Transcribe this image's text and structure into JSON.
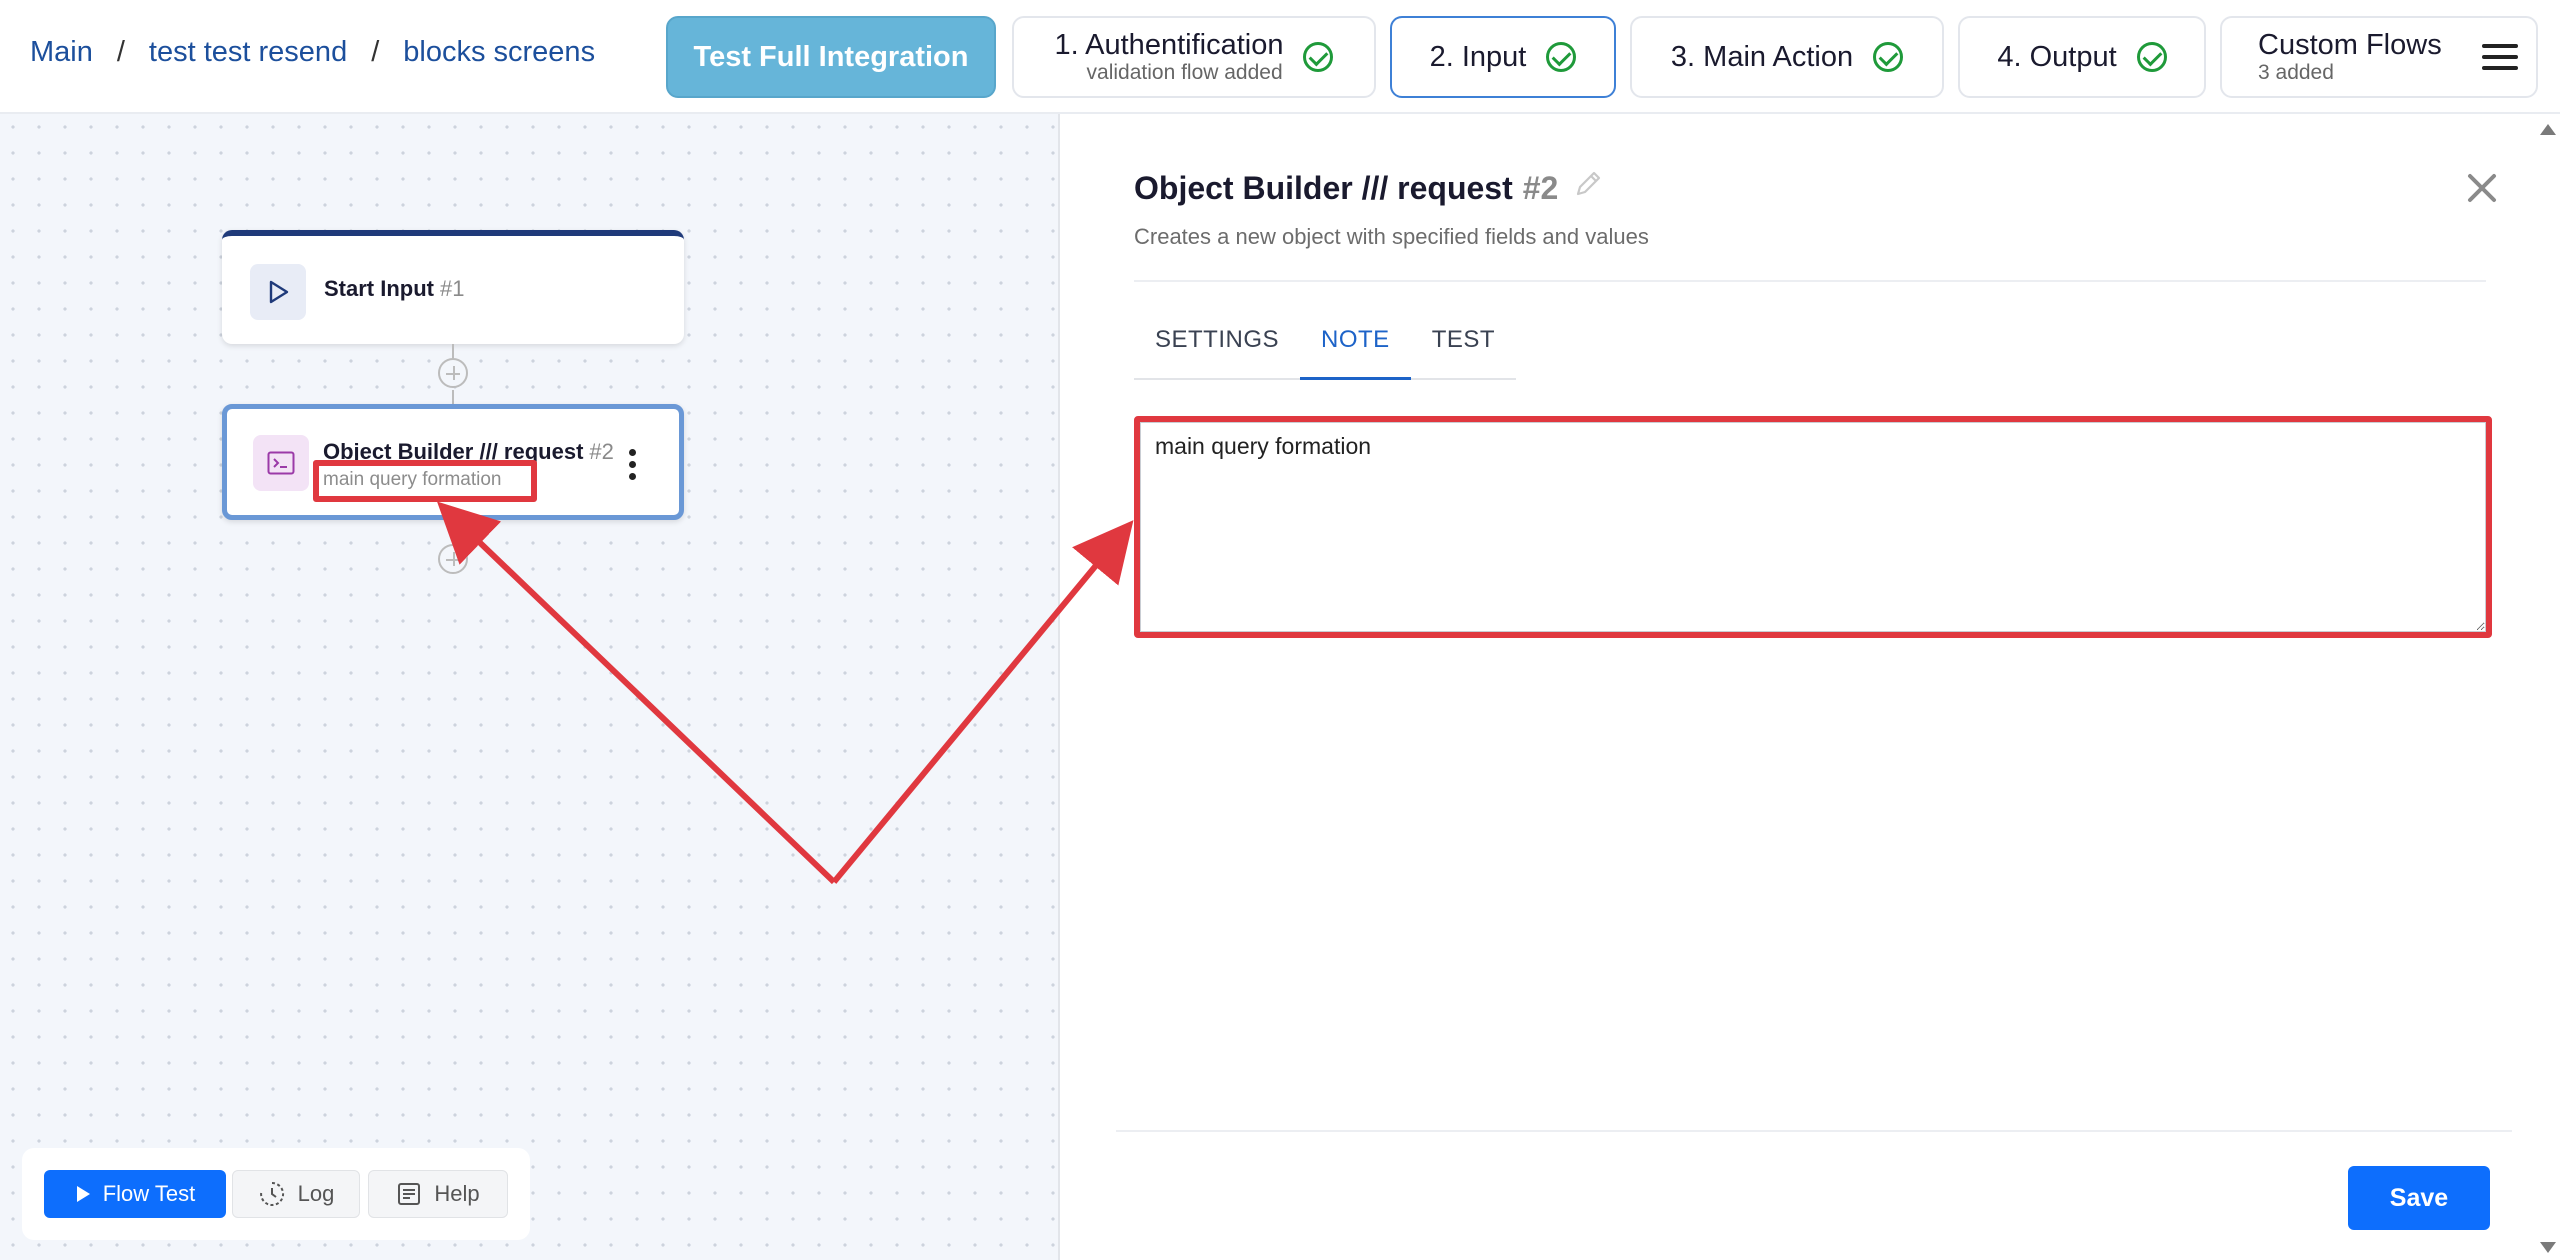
{
  "breadcrumb": [
    "Main",
    "test test resend",
    "blocks screens"
  ],
  "header": {
    "test_full": "Test Full Integration",
    "steps": [
      {
        "label": "1. Authentification",
        "sub": "validation flow added"
      },
      {
        "label": "2. Input"
      },
      {
        "label": "3. Main Action"
      },
      {
        "label": "4. Output"
      }
    ],
    "custom_flows": {
      "label": "Custom Flows",
      "sub": "3 added"
    }
  },
  "canvas": {
    "nodes": [
      {
        "title": "Start Input",
        "num": "#1"
      },
      {
        "title": "Object Builder /// request",
        "num": "#2",
        "note": "main query formation"
      }
    ],
    "toolbar": {
      "flow_test": "Flow Test",
      "log": "Log",
      "help": "Help"
    }
  },
  "panel": {
    "title": "Object Builder /// request",
    "num": "#2",
    "description": "Creates a new object with specified fields and values",
    "tabs": [
      "SETTINGS",
      "NOTE",
      "TEST"
    ],
    "active_tab": "NOTE",
    "note_value": "main query formation",
    "save": "Save"
  },
  "colors": {
    "accent": "#0d6efd",
    "annotation": "#e0383f",
    "success": "#1f9a3a",
    "test_button": "#66b5d9"
  },
  "icons": [
    "check-circle-icon",
    "hamburger-icon",
    "play-icon",
    "terminal-icon",
    "kebab-icon",
    "plus-circle-icon",
    "history-icon",
    "help-doc-icon",
    "pencil-icon",
    "close-icon"
  ]
}
